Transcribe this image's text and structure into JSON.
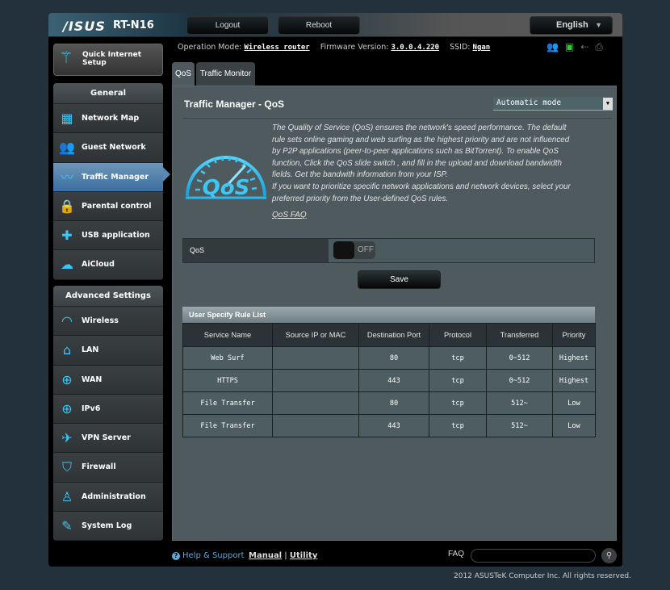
{
  "header": {
    "brand": "/ISUS",
    "model": "RT-N16",
    "logout_label": "Logout",
    "reboot_label": "Reboot",
    "language": "English"
  },
  "status": {
    "operation_mode_label": "Operation Mode:",
    "operation_mode_value": "Wireless router",
    "firmware_label": "Firmware Version:",
    "firmware_value": "3.0.0.4.220",
    "ssid_label": "SSID:",
    "ssid_value": "Ngan",
    "icons": [
      "clients-icon",
      "network-status-icon",
      "usb-icon",
      "printer-icon"
    ]
  },
  "sidebar": {
    "quick_setup_label": "Quick Internet Setup",
    "general": {
      "title": "General",
      "items": [
        {
          "label": "Network Map",
          "icon": "network-map-icon",
          "glyph": "▦"
        },
        {
          "label": "Guest Network",
          "icon": "guest-network-icon",
          "glyph": "👥"
        },
        {
          "label": "Traffic Manager",
          "icon": "traffic-manager-icon",
          "glyph": "〰",
          "active": true
        },
        {
          "label": "Parental control",
          "icon": "lock-icon",
          "glyph": "🔒"
        },
        {
          "label": "USB application",
          "icon": "puzzle-icon",
          "glyph": "✚"
        },
        {
          "label": "AiCloud",
          "icon": "cloud-home-icon",
          "glyph": "☁"
        }
      ]
    },
    "advanced": {
      "title": "Advanced Settings",
      "items": [
        {
          "label": "Wireless",
          "icon": "wifi-icon",
          "glyph": "◠"
        },
        {
          "label": "LAN",
          "icon": "home-icon",
          "glyph": "⌂"
        },
        {
          "label": "WAN",
          "icon": "globe-icon",
          "glyph": "⊕"
        },
        {
          "label": "IPv6",
          "icon": "ipv6-globe-icon",
          "glyph": "⊕"
        },
        {
          "label": "VPN Server",
          "icon": "vpn-icon",
          "glyph": "✈"
        },
        {
          "label": "Firewall",
          "icon": "shield-icon",
          "glyph": "⛉"
        },
        {
          "label": "Administration",
          "icon": "admin-user-icon",
          "glyph": "♙"
        },
        {
          "label": "System Log",
          "icon": "log-edit-icon",
          "glyph": "✎"
        }
      ]
    }
  },
  "tabs": [
    {
      "label": "QoS",
      "active": true
    },
    {
      "label": "Traffic Monitor",
      "active": false
    }
  ],
  "main": {
    "title": "Traffic Manager - QoS",
    "mode_select": "Automatic mode",
    "description_1": "The Quality of Service (QoS) ensures the network's speed performance. The default rule sets online gaming and web surfing as the highest priority and are not influenced by P2P applications (peer-to-peer applications such as BitTorrent). To enable QoS function, Click the QoS slide switch , and fill in the upload and download bandwidth fields. Get the bandwith information from your ISP.",
    "description_2": "If you want to prioritize specific network applications and network devices, select your preferred priority from the User-defined QoS rules.",
    "faq_link": "QoS FAQ",
    "qos_label": "QoS",
    "qos_toggle": "OFF",
    "save_label": "Save",
    "rule_list": {
      "title": "User Specify Rule List",
      "columns": [
        "Service Name",
        "Source IP or MAC",
        "Destination Port",
        "Protocol",
        "Transferred",
        "Priority"
      ],
      "rows": [
        [
          "Web Surf",
          "",
          "80",
          "tcp",
          "0~512",
          "Highest"
        ],
        [
          "HTTPS",
          "",
          "443",
          "tcp",
          "0~512",
          "Highest"
        ],
        [
          "File Transfer",
          "",
          "80",
          "tcp",
          "512~",
          "Low"
        ],
        [
          "File Transfer",
          "",
          "443",
          "tcp",
          "512~",
          "Low"
        ]
      ]
    }
  },
  "footer": {
    "help_label": "Help & Support",
    "manual_label": "Manual",
    "utility_label": "Utility",
    "faq_label": "FAQ",
    "faq_placeholder": "",
    "copyright": "2012 ASUSTeK Computer Inc. All rights reserved."
  },
  "colors": {
    "accent": "#3cc7f5",
    "active_nav": "#4f80b0",
    "status_on": "#2ecc2e",
    "background": "#22313b"
  }
}
